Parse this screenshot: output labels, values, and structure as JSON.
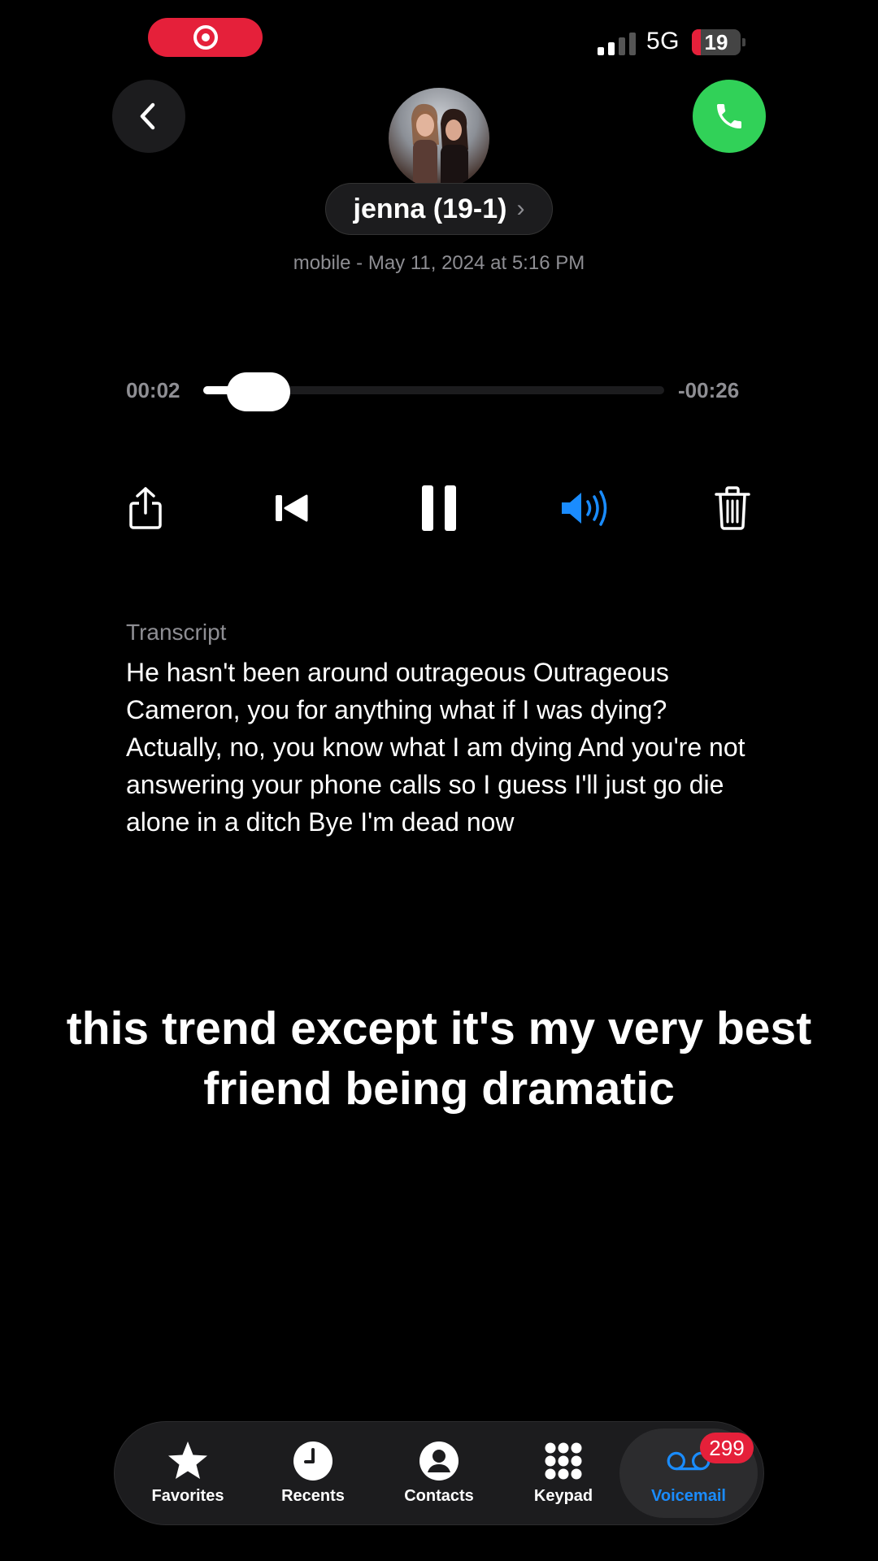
{
  "status_bar": {
    "network": "5G",
    "battery_level": "19",
    "battery_fraction": 0.19,
    "signal_bars": 2,
    "signal_bars_total": 4,
    "recording_indicator": "screen-record-icon"
  },
  "header": {
    "contact_name": "jenna (19-1)",
    "chevron": "›",
    "call_meta": "mobile - May 11, 2024 at 5:16 PM",
    "back_icon": "chevron-left-icon",
    "call_icon": "phone-icon"
  },
  "player": {
    "elapsed": "00:02",
    "remaining": "-00:26",
    "progress_fraction": 0.07
  },
  "controls": {
    "share_icon": "share-icon",
    "rewind_icon": "skip-back-icon",
    "pause_icon": "pause-icon",
    "speaker_icon": "speaker-icon",
    "delete_icon": "trash-icon"
  },
  "transcript": {
    "label": "Transcript",
    "text": "He hasn't been around outrageous Outrageous Cameron, you for anything what if I was dying? Actually, no, you know what I am dying And you're not answering your phone calls so I guess I'll just go die alone in a ditch Bye I'm dead now"
  },
  "caption": {
    "text": "this trend except it's my very best friend being dramatic"
  },
  "tab_bar": {
    "tabs": [
      {
        "label": "Favorites",
        "icon": "star-icon"
      },
      {
        "label": "Recents",
        "icon": "clock-icon"
      },
      {
        "label": "Contacts",
        "icon": "person-icon"
      },
      {
        "label": "Keypad",
        "icon": "keypad-icon"
      },
      {
        "label": "Voicemail",
        "icon": "voicemail-icon"
      }
    ],
    "selected": "Voicemail",
    "voicemail_badge": "299"
  },
  "colors": {
    "accent_blue": "#1a8cff",
    "call_green": "#31d158",
    "badge_red": "#e5203a",
    "secondary_text": "#8e8e93"
  }
}
